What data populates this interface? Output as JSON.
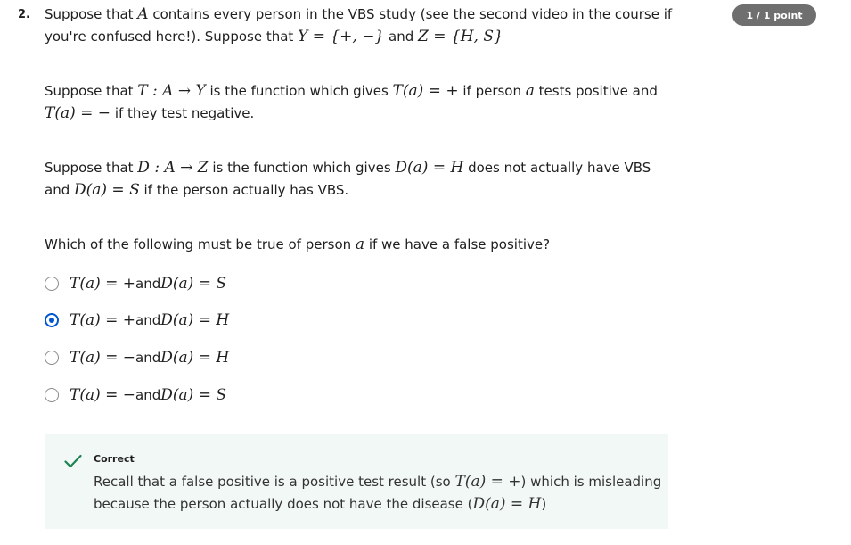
{
  "question": {
    "number": "2.",
    "badge": "1 / 1 point",
    "p1_l1": {
      "a": "Suppose that ",
      "A": "A",
      "b": " contains every person in the VBS study (see the second video in the course if"
    },
    "p1_l2": {
      "a": "you're confused here!). Suppose that ",
      "Y": "Y = {+, −}",
      "and": " and ",
      "Z": "Z = {H, S}"
    },
    "p2_l1": {
      "a": "Suppose that ",
      "map": "T : A → Y",
      "b": " is the function which gives ",
      "eq": "T(a) = +",
      "c": " if person ",
      "a_var": "a",
      "d": " tests positive and"
    },
    "p2_l2": {
      "eq": "T(a) = −",
      "b": " if they test negative."
    },
    "p3_l1": {
      "a": "Suppose that ",
      "map": "D : A → Z",
      "b": " is the function which gives ",
      "eq": "D(a) = H",
      "c": " does not actually have VBS"
    },
    "p3_l2": {
      "a": "and ",
      "eq": "D(a) = S",
      "b": " if the person actually has VBS."
    },
    "prompt": {
      "a": "Which of the following must be true of person ",
      "a_var": "a",
      "b": " if we have a false positive?"
    }
  },
  "options": [
    {
      "t": "T(a) = +",
      "and": " and ",
      "d": "D(a) = S",
      "selected": false
    },
    {
      "t": "T(a) = +",
      "and": " and ",
      "d": "D(a) = H",
      "selected": true
    },
    {
      "t": "T(a) = −",
      "and": " and ",
      "d": "D(a) = H",
      "selected": false
    },
    {
      "t": "T(a) = −",
      "and": " and ",
      "d": "D(a) = S",
      "selected": false
    }
  ],
  "feedback": {
    "title": "Correct",
    "l1": {
      "a": "Recall that a false positive is a positive test result (so ",
      "eq": "T(a) = +",
      "b": ") which is misleading"
    },
    "l2": {
      "a": "because the person actually does not have the disease (",
      "eq": "D(a) = H",
      "b": ")"
    }
  },
  "colors": {
    "accent": "#0056d2",
    "badge_bg": "#6f6f6f",
    "correct_green": "#1f8354",
    "feedback_bg": "#f2f8f5"
  }
}
